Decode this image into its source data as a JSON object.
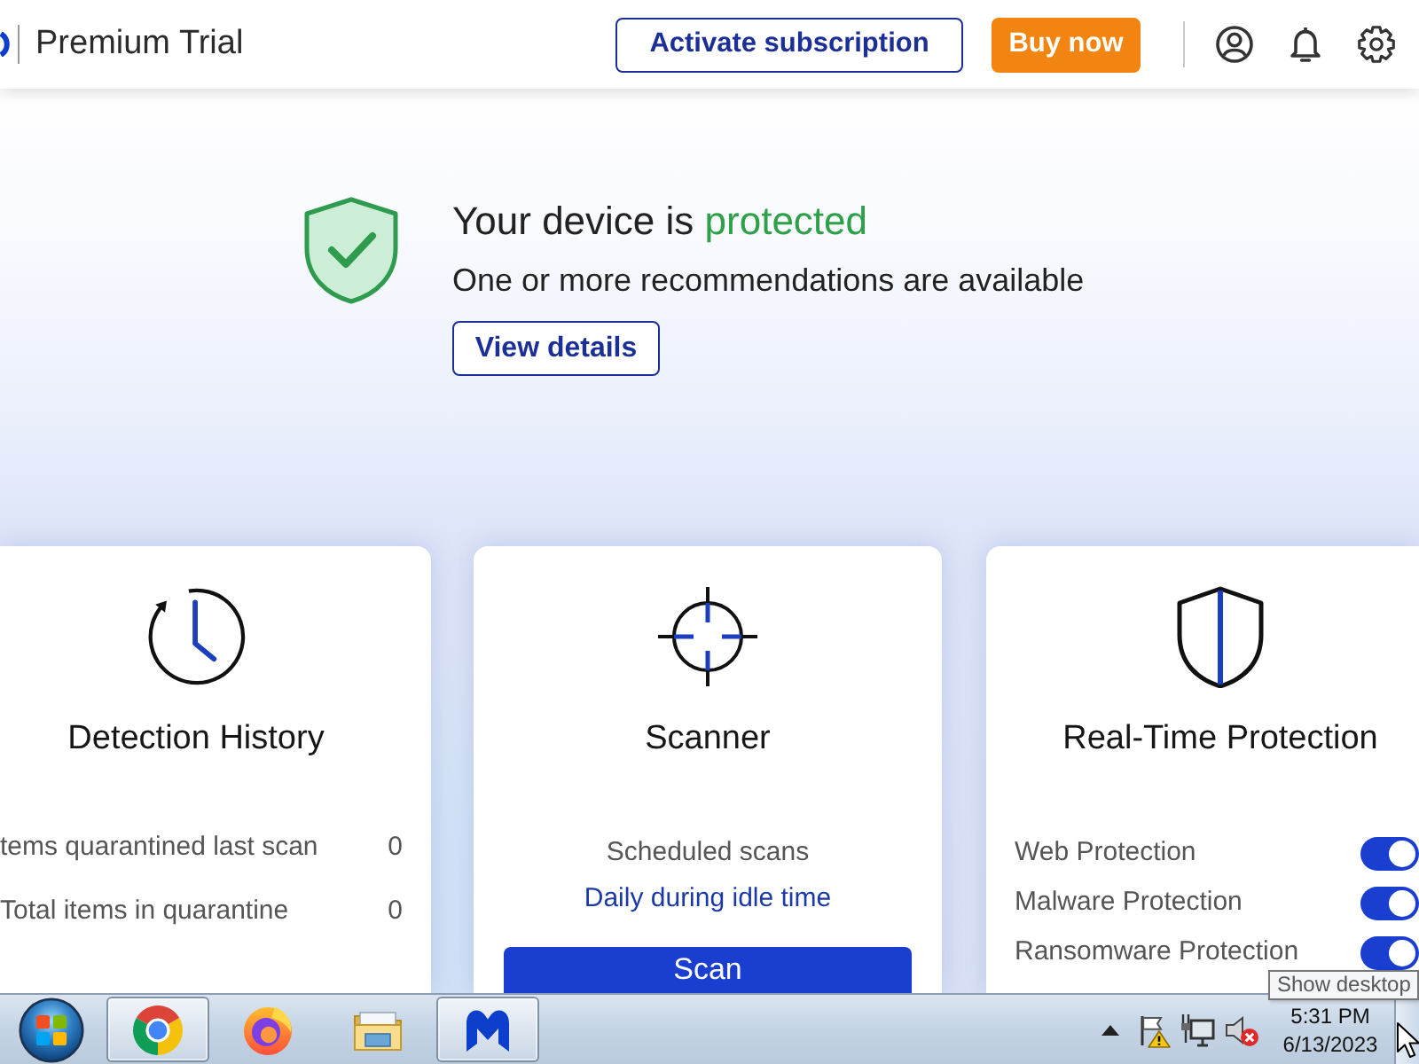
{
  "header": {
    "product": "Premium Trial",
    "actions": [
      {
        "label": "Activate subscription",
        "kind": "outline"
      },
      {
        "label": "Buy now",
        "kind": "solid"
      }
    ]
  },
  "status": {
    "protected": true,
    "headline": "Your device is",
    "state_text": "protected",
    "message": "One or more recommendations are available",
    "button": "View details"
  },
  "cards": [
    {
      "kind": "history",
      "title": "Detection History",
      "rows": [
        {
          "label": "tems quarantined last scan",
          "value": "0"
        },
        {
          "label": "Total items in quarantine",
          "value": "0"
        }
      ]
    },
    {
      "kind": "scanner",
      "title": "Scanner",
      "schedule_label": "Scheduled scans",
      "schedule": "Daily during idle time",
      "button": "Scan"
    },
    {
      "kind": "protection",
      "title": "Real-Time Protection",
      "toggles": [
        {
          "label": "Web Protection",
          "on": true
        },
        {
          "label": "Malware Protection",
          "on": true
        },
        {
          "label": "Ransomware Protection",
          "on": true
        }
      ]
    }
  ],
  "tooltip": "Show desktop",
  "taskbar": {
    "apps": [
      {
        "kind": "chrome",
        "running": true
      },
      {
        "kind": "firefox",
        "running": false
      },
      {
        "kind": "explorer",
        "running": false
      },
      {
        "kind": "malwarebytes",
        "running": true
      }
    ],
    "tray": {
      "alert": true,
      "muted": true
    },
    "clock": {
      "time": "5:31 PM",
      "date": "6/13/2023"
    }
  }
}
